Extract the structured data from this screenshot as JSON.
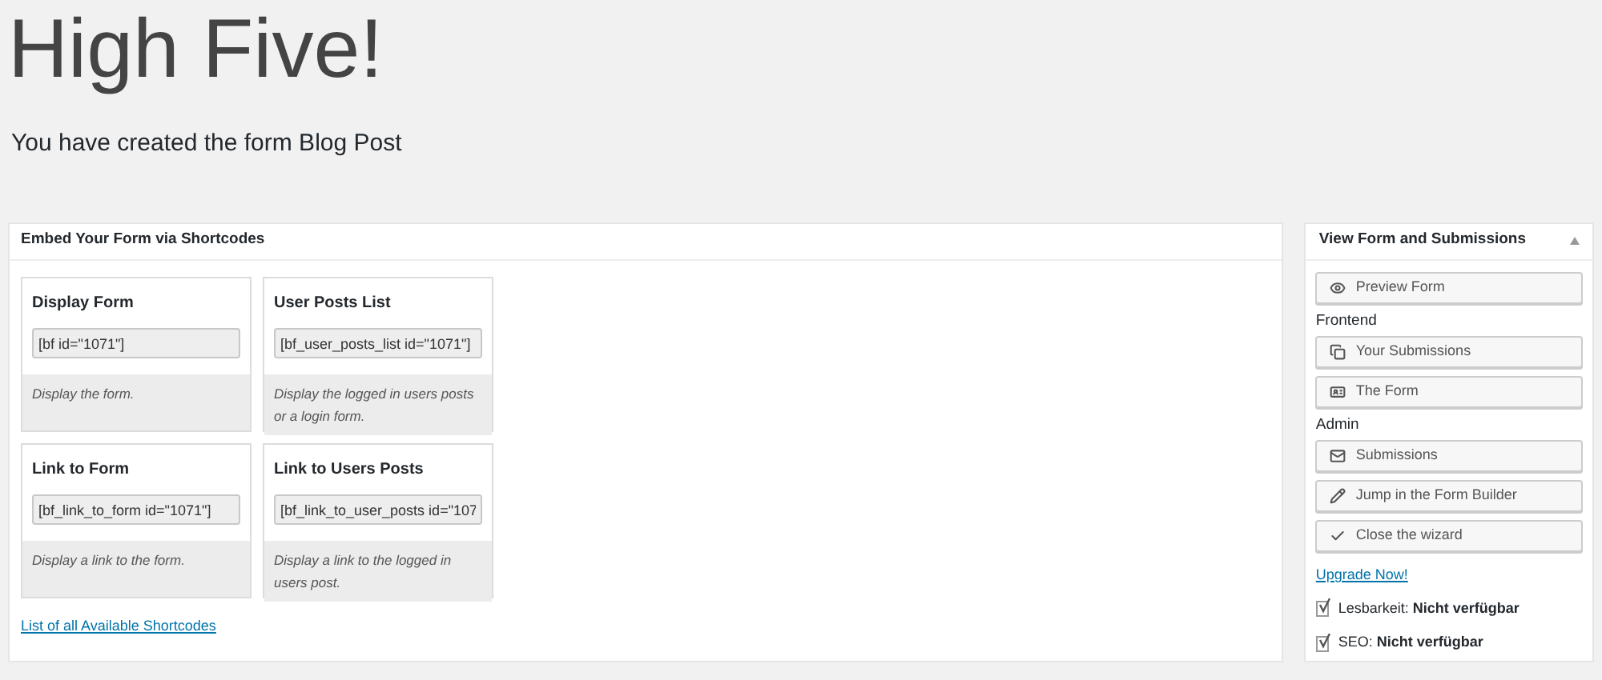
{
  "title": "High Five!",
  "subtitle": "You have created the form Blog Post",
  "embed_panel": {
    "title": "Embed Your Form via Shortcodes",
    "cards": [
      {
        "title": "Display Form",
        "shortcode": "[bf id=\"1071\"]",
        "description": "Display the form."
      },
      {
        "title": "User Posts List",
        "shortcode": "[bf_user_posts_list id=\"1071\"]",
        "description": "Display the logged in users posts or a login form."
      },
      {
        "title": "Link to Form",
        "shortcode": "[bf_link_to_form id=\"1071\"]",
        "description": "Display a link to the form."
      },
      {
        "title": "Link to Users Posts",
        "shortcode": "[bf_link_to_user_posts id=\"107",
        "description": "Display a link to the logged in users post."
      }
    ],
    "link": "List of all Available Shortcodes"
  },
  "side_panel": {
    "title": "View Form and Submissions",
    "expanded": true,
    "items": [
      {
        "kind": "button",
        "label": "Preview Form"
      },
      {
        "kind": "heading",
        "label": "Frontend"
      },
      {
        "kind": "button",
        "label": "Your Submissions"
      },
      {
        "kind": "button",
        "label": "The Form"
      },
      {
        "kind": "heading",
        "label": "Admin"
      },
      {
        "kind": "button",
        "label": "Submissions"
      },
      {
        "kind": "button",
        "label": "Jump in the Form Builder"
      },
      {
        "kind": "button",
        "label": "Close the wizard"
      },
      {
        "kind": "link",
        "label": "Upgrade Now!"
      },
      {
        "kind": "status",
        "label": "Lesbarkeit: **Nicht verfügbar**"
      },
      {
        "kind": "status",
        "label": "SEO: **Nicht verfügbar**"
      }
    ]
  }
}
